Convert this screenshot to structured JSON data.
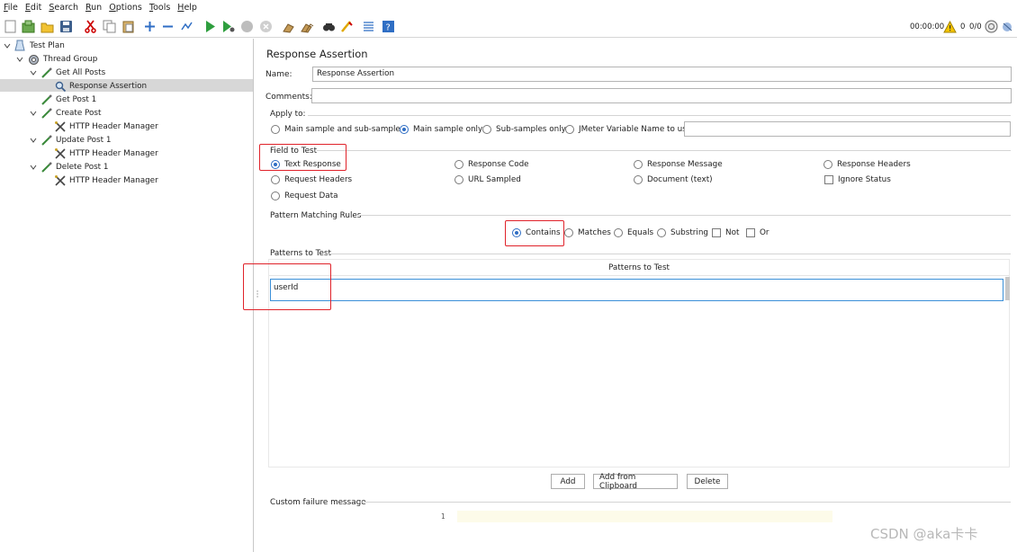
{
  "menu": [
    "File",
    "Edit",
    "Search",
    "Run",
    "Options",
    "Tools",
    "Help"
  ],
  "menu_mnemonic": [
    "F",
    "E",
    "S",
    "R",
    "O",
    "T",
    "H"
  ],
  "status": {
    "time": "00:00:00",
    "warnings": "0",
    "threads": "0/0"
  },
  "tree": {
    "items": [
      {
        "label": "Test Plan",
        "icon": "test-plan-icon"
      },
      {
        "label": "Thread Group",
        "icon": "gear-icon"
      },
      {
        "label": "Get All Posts",
        "icon": "sampler-pipette-icon"
      },
      {
        "label": "Response Assertion",
        "icon": "magnifier-icon",
        "selected": true
      },
      {
        "label": "Get Post 1",
        "icon": "sampler-pipette-icon"
      },
      {
        "label": "Create Post",
        "icon": "sampler-pipette-icon"
      },
      {
        "label": "HTTP Header Manager",
        "icon": "wrench-cross-icon"
      },
      {
        "label": "Update Post 1",
        "icon": "sampler-pipette-icon"
      },
      {
        "label": "HTTP Header Manager",
        "icon": "wrench-cross-icon"
      },
      {
        "label": "Delete Post 1",
        "icon": "sampler-pipette-icon"
      },
      {
        "label": "HTTP Header Manager",
        "icon": "wrench-cross-icon"
      }
    ]
  },
  "panel": {
    "title": "Response Assertion",
    "name_label": "Name:",
    "name_value": "Response Assertion",
    "comments_label": "Comments:",
    "comments_value": "",
    "apply_to": {
      "label": "Apply to:",
      "options": [
        "Main sample and sub-samples",
        "Main sample only",
        "Sub-samples only",
        "JMeter Variable Name to use"
      ],
      "selected": "Main sample only",
      "variable_value": ""
    },
    "field_to_test": {
      "label": "Field to Test",
      "options": [
        "Text Response",
        "Response Code",
        "Response Message",
        "Response Headers",
        "Request Headers",
        "URL Sampled",
        "Document (text)",
        "Ignore Status",
        "Request Data"
      ],
      "selected": "Text Response",
      "ignore_status_checked": false
    },
    "pattern_rules": {
      "label": "Pattern Matching Rules",
      "options": [
        "Contains",
        "Matches",
        "Equals",
        "Substring",
        "Not",
        "Or"
      ],
      "selected": "Contains"
    },
    "patterns": {
      "label": "Patterns to Test",
      "column": "Patterns to Test",
      "rows": [
        "userId"
      ]
    },
    "buttons": {
      "add": "Add",
      "add_clipboard": "Add from Clipboard",
      "delete": "Delete"
    },
    "failure": {
      "label": "Custom failure message",
      "line_number": "1",
      "value": ""
    }
  },
  "colors": {
    "highlight": "#e0222a",
    "accent": "#2f6ec4",
    "selection": "#d7d7d7"
  },
  "watermark": "CSDN @aka卡卡"
}
